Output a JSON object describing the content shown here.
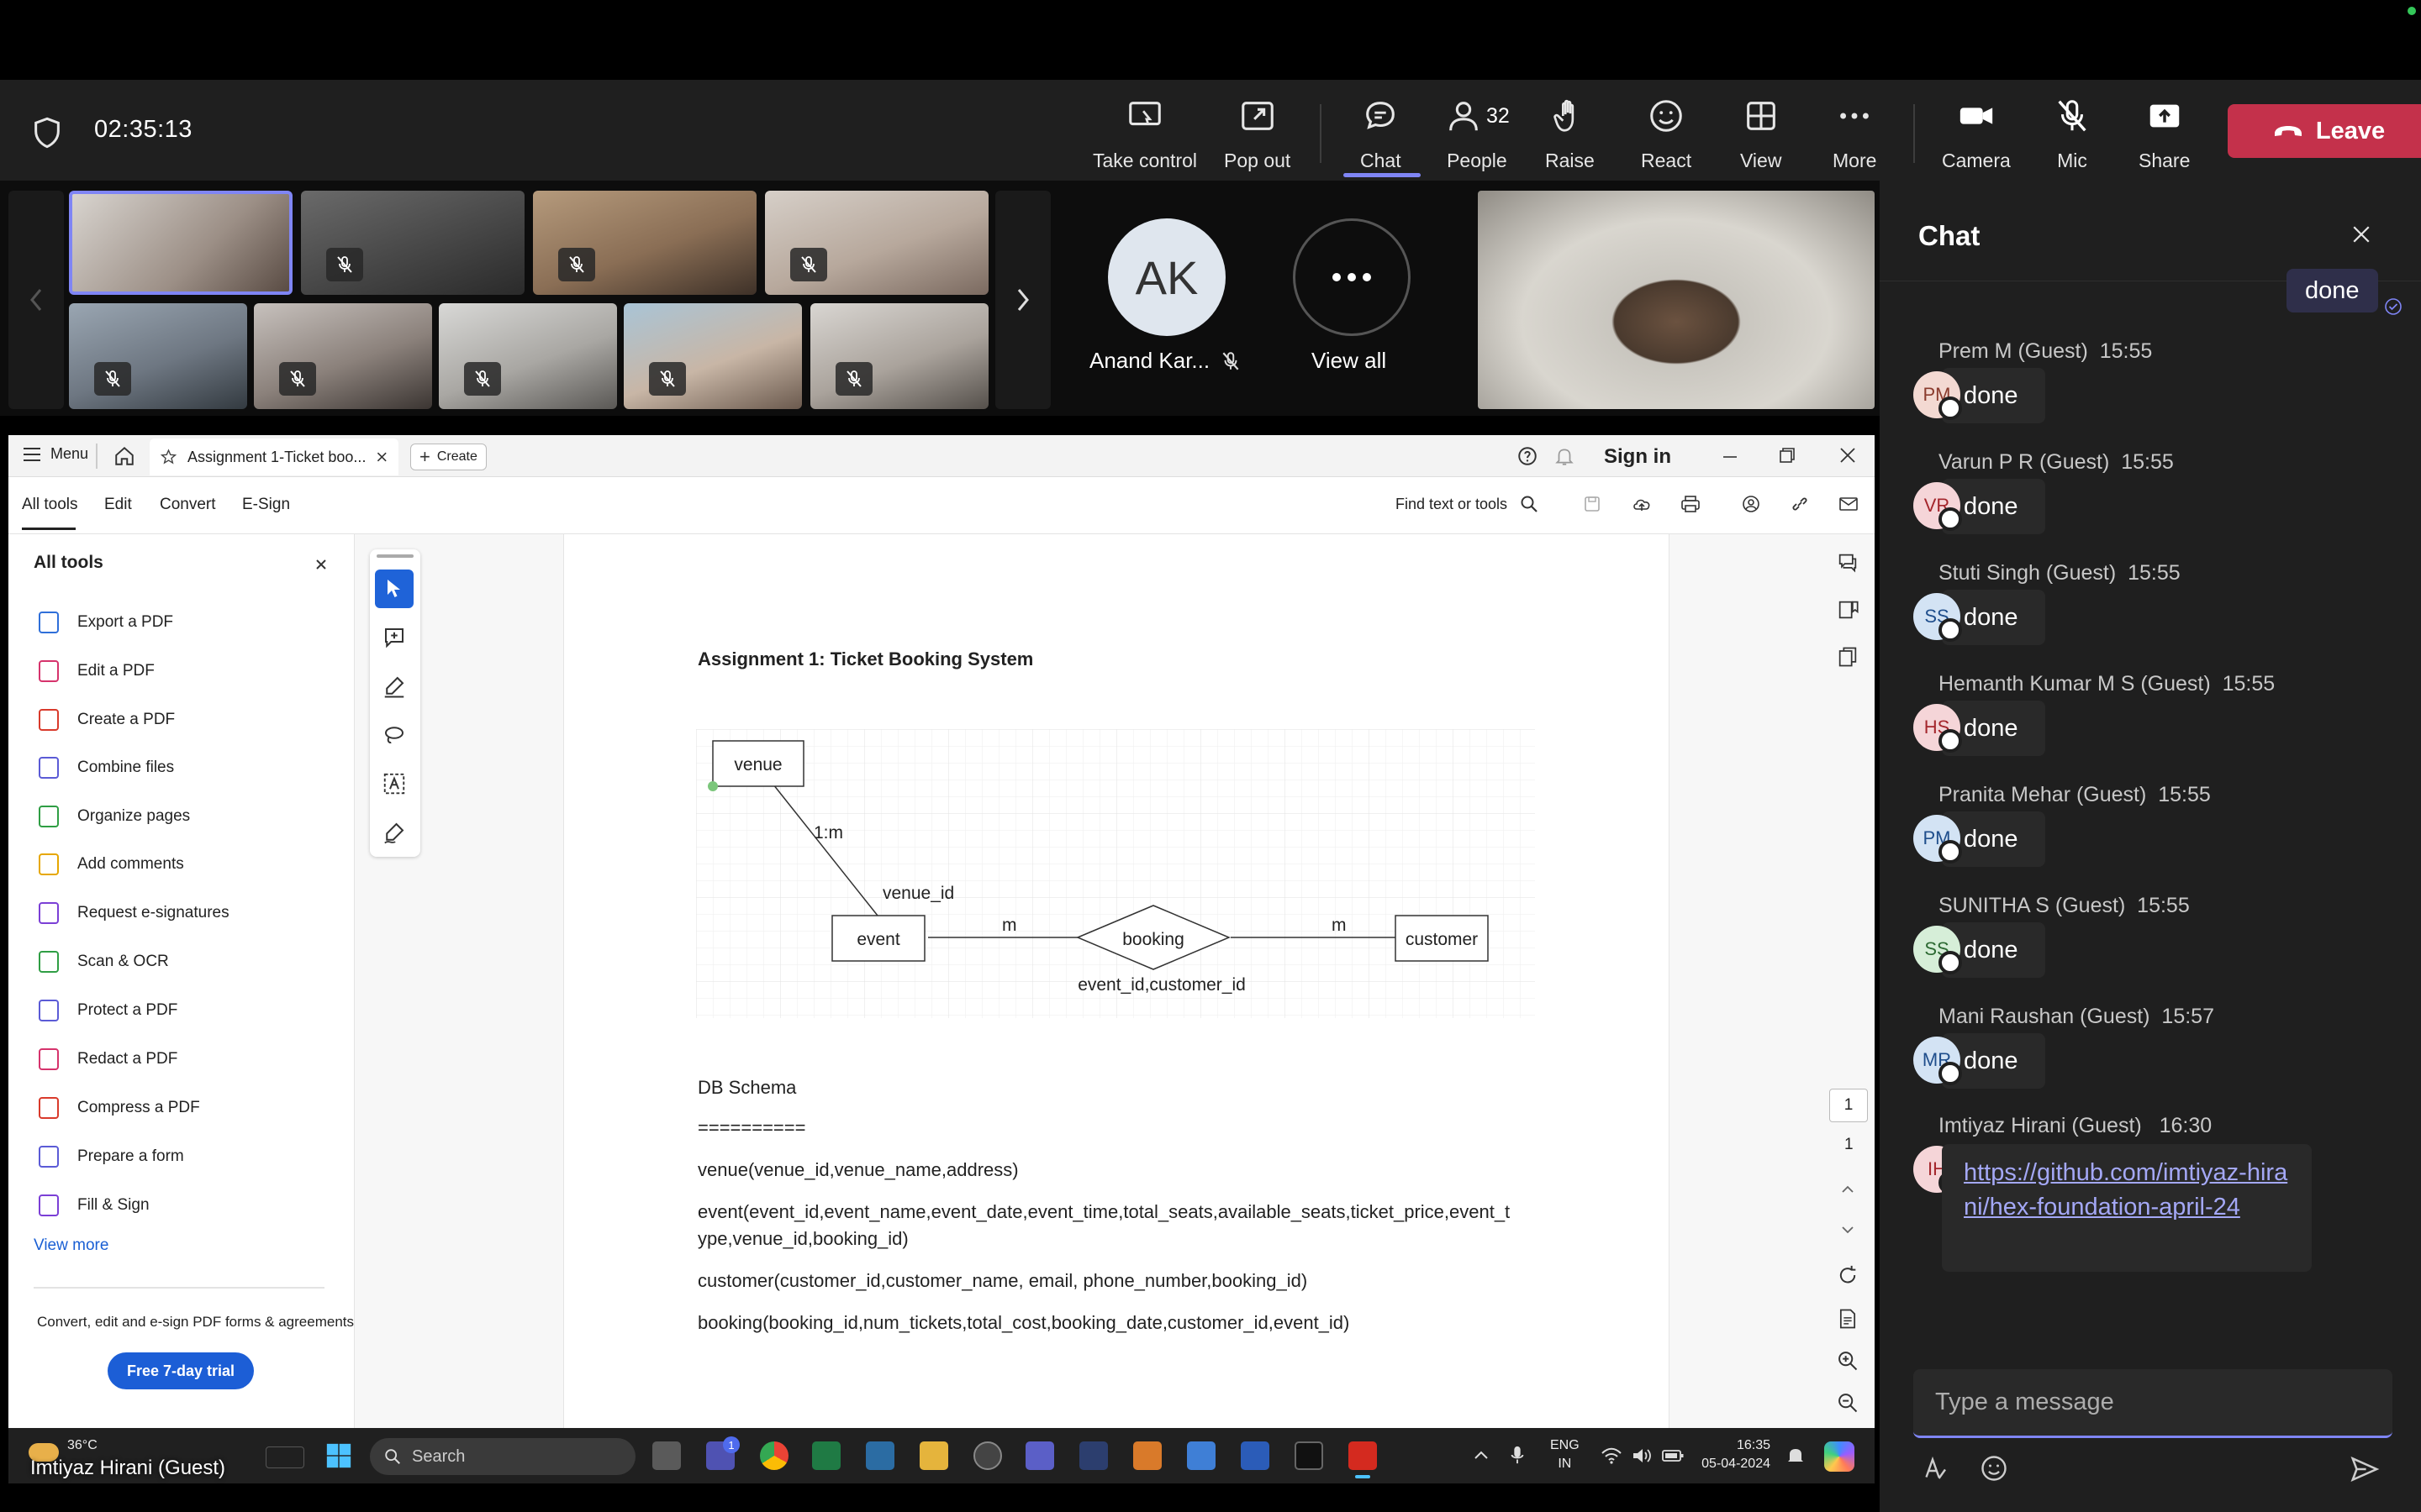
{
  "meeting": {
    "timer": "02:35:13",
    "buttons": {
      "take_control": "Take control",
      "pop_out": "Pop out",
      "chat": "Chat",
      "people": "People",
      "people_count": "32",
      "raise": "Raise",
      "react": "React",
      "view": "View",
      "more": "More",
      "camera": "Camera",
      "mic": "Mic",
      "share": "Share",
      "leave": "Leave"
    },
    "accent_color": "#7f85f5",
    "leave_color": "#c4314b"
  },
  "video_strip": {
    "participant_initials": "AK",
    "participant_name": "Anand Kar...",
    "view_all": "View all",
    "presenter_name": "Imtiyaz Hirani (Guest)"
  },
  "acrobat": {
    "menu": "Menu",
    "tab_title": "Assignment 1-Ticket boo...",
    "create": "Create",
    "sign_in": "Sign in",
    "toolbar_tabs": [
      "All tools",
      "Edit",
      "Convert",
      "E-Sign"
    ],
    "find_placeholder": "Find text or tools",
    "panel_title": "All tools",
    "tools": [
      {
        "label": "Export a PDF",
        "color": "#2f6fd9"
      },
      {
        "label": "Edit a PDF",
        "color": "#d6336c"
      },
      {
        "label": "Create a PDF",
        "color": "#d93a2b"
      },
      {
        "label": "Combine files",
        "color": "#5b5bd6"
      },
      {
        "label": "Organize pages",
        "color": "#2f9e44"
      },
      {
        "label": "Add comments",
        "color": "#e6a700"
      },
      {
        "label": "Request e-signatures",
        "color": "#7b3fd6"
      },
      {
        "label": "Scan & OCR",
        "color": "#2f9e44"
      },
      {
        "label": "Protect a PDF",
        "color": "#5b5bd6"
      },
      {
        "label": "Redact a PDF",
        "color": "#d6336c"
      },
      {
        "label": "Compress a PDF",
        "color": "#d93a2b"
      },
      {
        "label": "Prepare a form",
        "color": "#5b5bd6"
      },
      {
        "label": "Fill & Sign",
        "color": "#7b3fd6"
      }
    ],
    "view_more": "View more",
    "promo_text": "Convert, edit and e-sign PDF forms & agreements",
    "trial_button": "Free 7-day trial",
    "page_current": "1",
    "page_total": "1"
  },
  "document": {
    "title": "Assignment 1: Ticket Booking System",
    "diagram": {
      "venue": "venue",
      "event": "event",
      "booking": "booking",
      "customer": "customer",
      "rel_venue_event": "1:m",
      "venue_fk": "venue_id",
      "m_left": "m",
      "m_right": "m",
      "booking_fk": "event_id,customer_id"
    },
    "schema_heading": "DB Schema",
    "schema_rule": "==========",
    "schema_lines": [
      "venue(venue_id,venue_name,address)",
      "event(event_id,event_name,event_date,event_time,total_seats,available_seats,ticket_price,event_t",
      "ype,venue_id,booking_id)",
      "customer(customer_id,customer_name, email, phone_number,booking_id)",
      "booking(booking_id,num_tickets,total_cost,booking_date,customer_id,event_id)"
    ]
  },
  "taskbar": {
    "weather": "36°C",
    "search": "Search",
    "lang_top": "ENG",
    "lang_bottom": "IN",
    "time": "16:35",
    "date": "05-04-2024",
    "badge": "1"
  },
  "chat": {
    "title": "Chat",
    "partial_own_message": "done",
    "messages": [
      {
        "author": "Prem M (Guest)",
        "time": "15:55",
        "initials": "PM",
        "text": "done",
        "avatar_bg": "#f3d9d2",
        "avatar_fg": "#8a3b2d"
      },
      {
        "author": "Varun P R (Guest)",
        "time": "15:55",
        "initials": "VR",
        "text": "done",
        "avatar_bg": "#f5d5d8",
        "avatar_fg": "#a4262c"
      },
      {
        "author": "Stuti Singh (Guest)",
        "time": "15:55",
        "initials": "SS",
        "text": "done",
        "avatar_bg": "#d3e3f4",
        "avatar_fg": "#1f4e8c"
      },
      {
        "author": "Hemanth Kumar M S (Guest)",
        "time": "15:55",
        "initials": "HS",
        "text": "done",
        "avatar_bg": "#f5d5d8",
        "avatar_fg": "#a4262c"
      },
      {
        "author": "Pranita Mehar (Guest)",
        "time": "15:55",
        "initials": "PM",
        "text": "done",
        "avatar_bg": "#d3e3f4",
        "avatar_fg": "#1f4e8c"
      },
      {
        "author": "SUNITHA S (Guest)",
        "time": "15:55",
        "initials": "SS",
        "text": "done",
        "avatar_bg": "#d6eed8",
        "avatar_fg": "#2d6a33"
      },
      {
        "author": "Mani Raushan (Guest)",
        "time": "15:57",
        "initials": "MR",
        "text": "done",
        "avatar_bg": "#d3e3f4",
        "avatar_fg": "#1f4e8c"
      }
    ],
    "last_message": {
      "author": "Imtiyaz Hirani (Guest)",
      "time": "16:30",
      "initials": "IH",
      "link": "https://github.com/imtiyaz-hirani/hex-foundation-april-24"
    },
    "compose_placeholder": "Type a message"
  }
}
